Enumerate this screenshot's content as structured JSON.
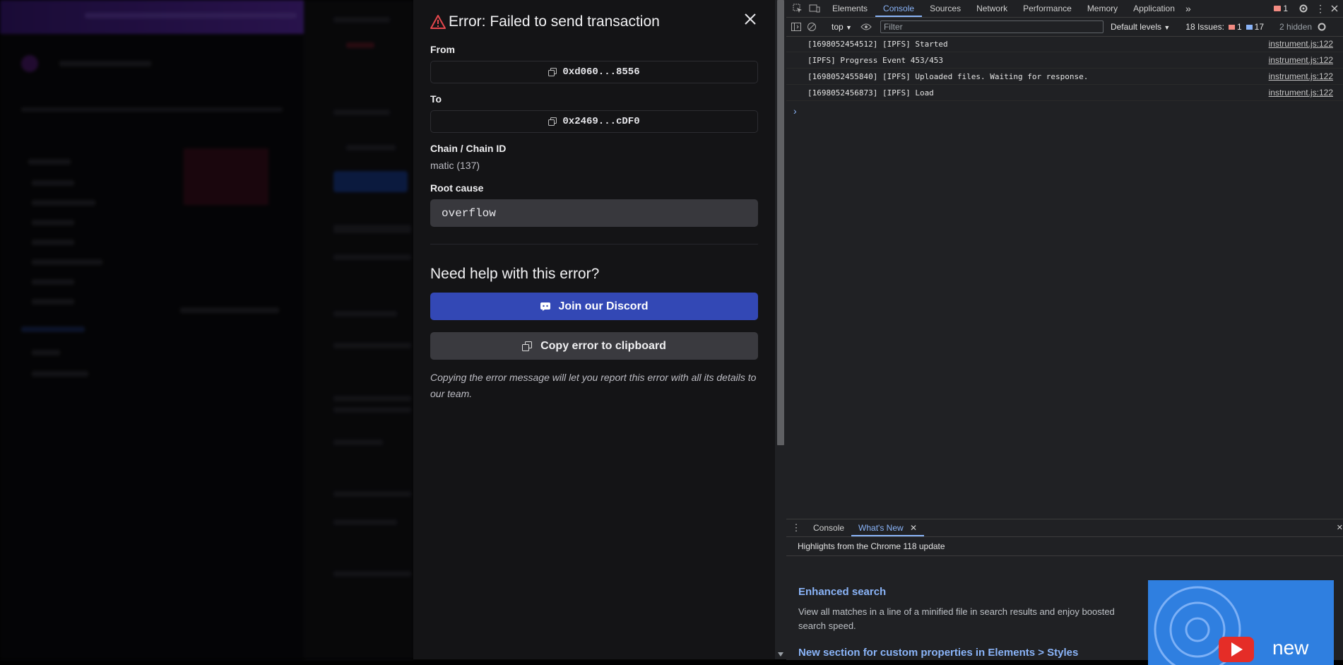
{
  "modal": {
    "title": "Error: Failed to send transaction",
    "from_label": "From",
    "from_address": "0xd060...8556",
    "to_label": "To",
    "to_address": "0x2469...cDF0",
    "chain_label": "Chain / Chain ID",
    "chain_value": "matic (137)",
    "root_cause_label": "Root cause",
    "root_cause_value": "overflow",
    "help_title": "Need help with this error?",
    "discord_button": "Join our Discord",
    "copy_button": "Copy error to clipboard",
    "help_note": "Copying the error message will let you report this error with all its details to our team.",
    "colors": {
      "error": "#e5484d",
      "discord": "#3348b5"
    }
  },
  "devtools": {
    "tabs": [
      "Elements",
      "Console",
      "Sources",
      "Network",
      "Performance",
      "Memory",
      "Application"
    ],
    "active_tab": "Console",
    "error_badge": "1",
    "context": "top",
    "filter_placeholder": "Filter",
    "levels": "Default levels",
    "issues_label": "18 Issues:",
    "issues_errors": "1",
    "issues_info": "17",
    "hidden": "2 hidden",
    "logs": [
      {
        "message": "[1698052454512] [IPFS] Started",
        "source": "instrument.js:122"
      },
      {
        "message": "[IPFS] Progress Event 453/453",
        "source": "instrument.js:122"
      },
      {
        "message": "[1698052455840] [IPFS] Uploaded files. Waiting for response.",
        "source": "instrument.js:122"
      },
      {
        "message": "[1698052456873] [IPFS] Load",
        "source": "instrument.js:122"
      }
    ],
    "drawer": {
      "tabs": [
        "Console",
        "What's New"
      ],
      "active_tab": "What's New",
      "highlights": "Highlights from the Chrome 118 update",
      "items": [
        {
          "title": "Enhanced search",
          "desc": "View all matches in a line of a minified file in search results and enjoy boosted search speed."
        },
        {
          "title": "New section for custom properties in Elements > Styles"
        }
      ],
      "thumb_text": "new"
    }
  }
}
